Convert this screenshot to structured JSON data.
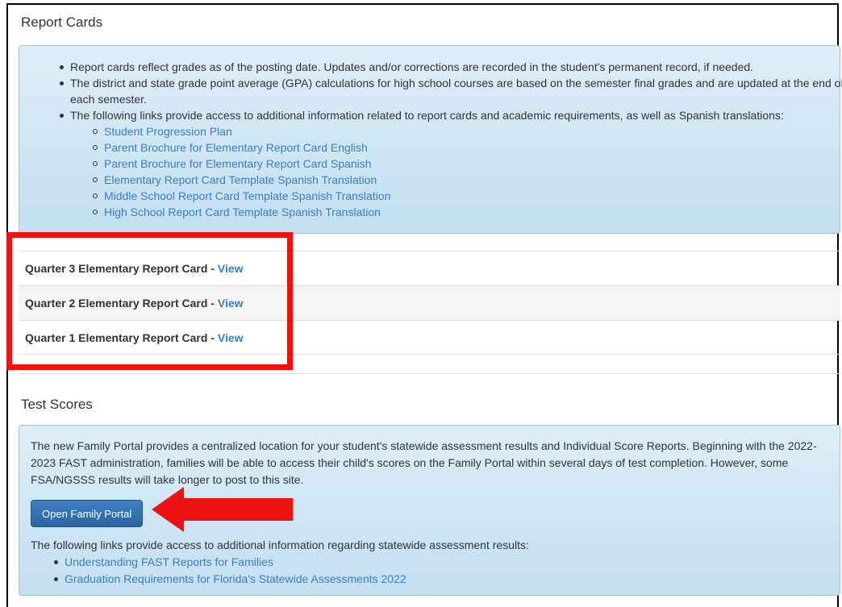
{
  "report_cards": {
    "title": "Report Cards",
    "bullets": [
      "Report cards reflect grades as of the posting date. Updates and/or corrections are recorded in the student's permanent record, if needed.",
      "The district and state grade point average (GPA) calculations for high school courses are based on the semester final grades and are updated at the end of each semester.",
      "The following links provide access to additional information related to report cards and academic requirements, as well as Spanish translations:"
    ],
    "sub_links": [
      "Student Progression Plan",
      "Parent Brochure for Elementary Report Card English",
      "Parent Brochure for Elementary Report Card Spanish",
      "Elementary Report Card Template Spanish Translation",
      "Middle School Report Card Template Spanish Translation",
      "High School Report Card Template Spanish Translation"
    ],
    "rows": [
      {
        "label": "Quarter 3 Elementary Report Card - ",
        "link": "View"
      },
      {
        "label": "Quarter 2 Elementary Report Card - ",
        "link": "View"
      },
      {
        "label": "Quarter 1 Elementary Report Card - ",
        "link": "View"
      }
    ]
  },
  "test_scores": {
    "title": "Test Scores",
    "intro": "The new Family Portal provides a centralized location for your student's statewide assessment results and Individual Score Reports. Beginning with the 2022-2023 FAST administration, families will be able to access their child's scores on the Family Portal within several days of test completion. However, some FSA/NGSSS results will take longer to post to this site.",
    "button_label": "Open Family Portal",
    "following_text": "The following links provide access to additional information regarding statewide assessment results:",
    "links": [
      "Understanding FAST Reports for Families",
      "Graduation Requirements for Florida's Statewide Assessments 2022"
    ]
  },
  "colors": {
    "highlight": "#ee1111",
    "link": "#3a7ebd",
    "button": "#2f6fb0"
  },
  "icons": {
    "arrow": "red-left-arrow-icon"
  }
}
